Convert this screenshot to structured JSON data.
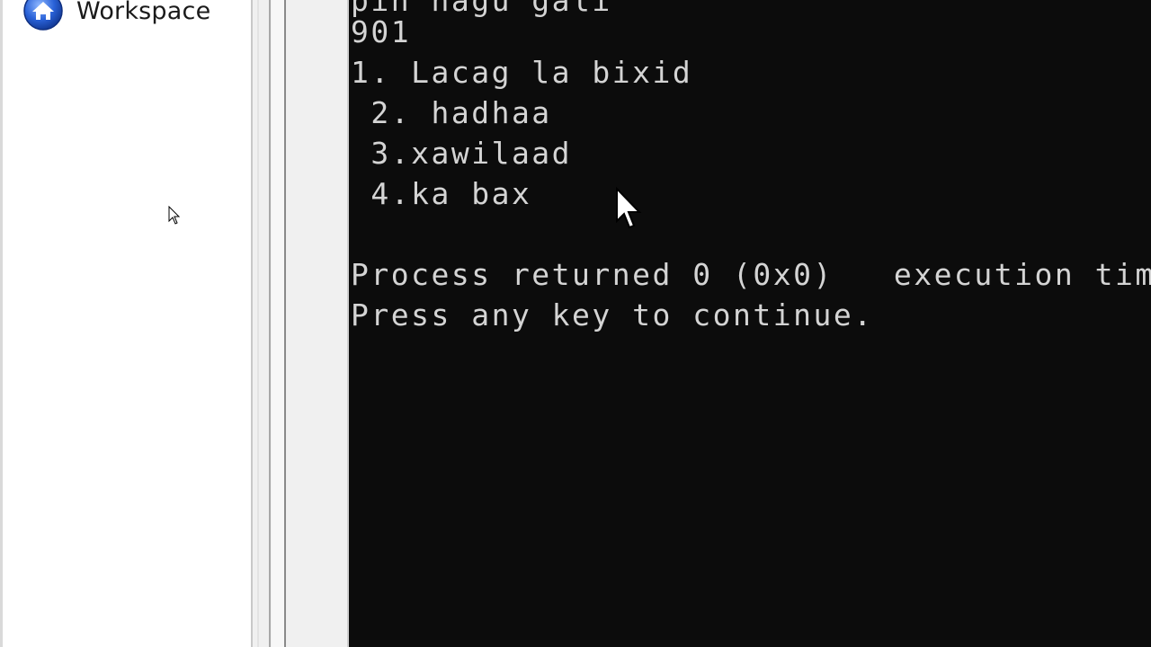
{
  "workspace": {
    "label": "Workspace",
    "icon": "home-icon"
  },
  "console": {
    "background": "#0c0c0c",
    "text_color": "#d4d4d4",
    "lines": [
      "pin hagu gali",
      "901",
      "1. Lacag la bixid",
      " 2. hadhaa",
      " 3.xawilaad",
      " 4.ka bax",
      "",
      "Process returned 0 (0x0)   execution tim",
      "Press any key to continue."
    ]
  },
  "cursors": [
    "mouse-pointer-icon",
    "mouse-pointer-icon"
  ]
}
